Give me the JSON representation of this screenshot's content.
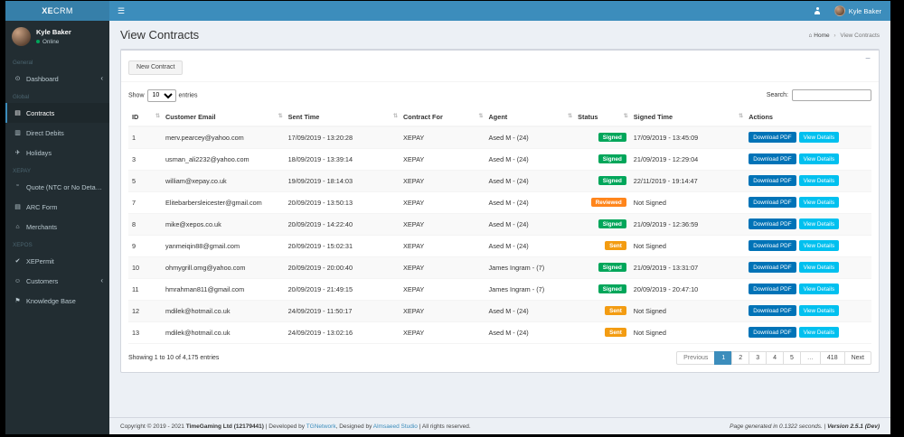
{
  "app": {
    "brand_bold": "XE",
    "brand_rest": "CRM"
  },
  "navbar": {
    "user_name": "Kyle Baker"
  },
  "icons": {
    "hamburger": "☰",
    "home": "⌂",
    "sort": "⇅",
    "chevron_left": "‹"
  },
  "sidebar": {
    "user": {
      "name": "Kyle Baker",
      "status": "Online"
    },
    "items": [
      {
        "type": "header",
        "label": "General"
      },
      {
        "type": "link",
        "label": "Dashboard",
        "icon": "dashboard-icon",
        "glyph": "⊙",
        "chevron": true
      },
      {
        "type": "header",
        "label": "Global"
      },
      {
        "type": "link",
        "label": "Contracts",
        "icon": "contracts-icon",
        "glyph": "▤",
        "active": true
      },
      {
        "type": "link",
        "label": "Direct Debits",
        "icon": "credit-card-icon",
        "glyph": "▥"
      },
      {
        "type": "link",
        "label": "Holidays",
        "icon": "plane-icon",
        "glyph": "✈"
      },
      {
        "type": "header",
        "label": "XEPAY"
      },
      {
        "type": "link",
        "label": "Quote (NTC or No Details)",
        "icon": "quote-icon",
        "glyph": "“"
      },
      {
        "type": "link",
        "label": "ARC Form",
        "icon": "file-icon",
        "glyph": "▤"
      },
      {
        "type": "link",
        "label": "Merchants",
        "icon": "store-icon",
        "glyph": "⌂"
      },
      {
        "type": "header",
        "label": "XEPOS"
      },
      {
        "type": "link",
        "label": "XEPermit",
        "icon": "check-icon",
        "glyph": "✔"
      },
      {
        "type": "link",
        "label": "Customers",
        "icon": "users-icon",
        "glyph": "☺",
        "chevron": true
      },
      {
        "type": "link",
        "label": "Knowledge Base",
        "icon": "flag-icon",
        "glyph": "⚑"
      }
    ]
  },
  "page": {
    "title": "View Contracts",
    "breadcrumb": {
      "home": "Home",
      "separator": "›",
      "current": "View Contracts"
    }
  },
  "card": {
    "new_contract_label": "New Contract",
    "collapse_icon": "−"
  },
  "table_controls": {
    "show_label": "Show",
    "page_length": "10",
    "entries_label": "entries",
    "search_label": "Search:"
  },
  "table": {
    "columns": [
      "ID",
      "Customer Email",
      "Sent Time",
      "Contract For",
      "Agent",
      "Status",
      "Signed Time",
      "Actions"
    ],
    "actions": {
      "download": "Download PDF",
      "view": "View Details"
    },
    "rows": [
      {
        "id": "1",
        "email": "merv.pearcey@yahoo.com",
        "sent": "17/09/2019 - 13:20:28",
        "contract_for": "XEPAY",
        "agent": "Ased M - (24)",
        "status": "Signed",
        "status_type": "signed",
        "signed": "17/09/2019 - 13:45:09"
      },
      {
        "id": "3",
        "email": "usman_ali2232@yahoo.com",
        "sent": "18/09/2019 - 13:39:14",
        "contract_for": "XEPAY",
        "agent": "Ased M - (24)",
        "status": "Signed",
        "status_type": "signed",
        "signed": "21/09/2019 - 12:29:04"
      },
      {
        "id": "5",
        "email": "william@xepay.co.uk",
        "sent": "19/09/2019 - 18:14:03",
        "contract_for": "XEPAY",
        "agent": "Ased M - (24)",
        "status": "Signed",
        "status_type": "signed",
        "signed": "22/11/2019 - 19:14:47"
      },
      {
        "id": "7",
        "email": "Elitebarbersleicester@gmail.com",
        "sent": "20/09/2019 - 13:50:13",
        "contract_for": "XEPAY",
        "agent": "Ased M - (24)",
        "status": "Reviewed",
        "status_type": "reviewed",
        "signed": "Not Signed"
      },
      {
        "id": "8",
        "email": "mike@xepos.co.uk",
        "sent": "20/09/2019 - 14:22:40",
        "contract_for": "XEPAY",
        "agent": "Ased M - (24)",
        "status": "Signed",
        "status_type": "signed",
        "signed": "21/09/2019 - 12:36:59"
      },
      {
        "id": "9",
        "email": "yanmeiqin88@gmail.com",
        "sent": "20/09/2019 - 15:02:31",
        "contract_for": "XEPAY",
        "agent": "Ased M - (24)",
        "status": "Sent",
        "status_type": "sent",
        "signed": "Not Signed"
      },
      {
        "id": "10",
        "email": "ohmygrill.omg@yahoo.com",
        "sent": "20/09/2019 - 20:00:40",
        "contract_for": "XEPAY",
        "agent": "James Ingram - (7)",
        "status": "Signed",
        "status_type": "signed",
        "signed": "21/09/2019 - 13:31:07"
      },
      {
        "id": "11",
        "email": "hmrahman811@gmail.com",
        "sent": "20/09/2019 - 21:49:15",
        "contract_for": "XEPAY",
        "agent": "James Ingram - (7)",
        "status": "Signed",
        "status_type": "signed",
        "signed": "20/09/2019 - 20:47:10"
      },
      {
        "id": "12",
        "email": "mdilek@hotmail.co.uk",
        "sent": "24/09/2019 - 11:50:17",
        "contract_for": "XEPAY",
        "agent": "Ased M - (24)",
        "status": "Sent",
        "status_type": "sent",
        "signed": "Not Signed"
      },
      {
        "id": "13",
        "email": "mdilek@hotmail.co.uk",
        "sent": "24/09/2019 - 13:02:16",
        "contract_for": "XEPAY",
        "agent": "Ased M - (24)",
        "status": "Sent",
        "status_type": "sent",
        "signed": "Not Signed"
      }
    ]
  },
  "table_footer": {
    "info": "Showing 1 to 10 of 4,175 entries",
    "pagination": {
      "previous": "Previous",
      "pages": [
        "1",
        "2",
        "3",
        "4",
        "5",
        "…",
        "418"
      ],
      "active": "1",
      "next": "Next"
    }
  },
  "footer": {
    "copyright_prefix": "Copyright © 2019 - 2021 ",
    "company": "TimeGaming Ltd (12179441)",
    "developed_by": " | Developed by ",
    "dev_link": "TGNetwork",
    "designed_by": ", Designed by ",
    "design_link": "Almsaeed Studio",
    "rights": " | All rights reserved.",
    "generated": "Page generated in 0.1322 seconds. | ",
    "version": "Version 2.5.1 (Dev)"
  },
  "colors": {
    "navbar": "#3c8dbc",
    "brand_bg": "#367fa9",
    "sidebar_bg": "#222d32",
    "status_signed": "#00a65a",
    "status_reviewed": "#ff851b",
    "status_sent": "#f39c12",
    "btn_download": "#0073b7",
    "btn_view": "#00c0ef"
  }
}
